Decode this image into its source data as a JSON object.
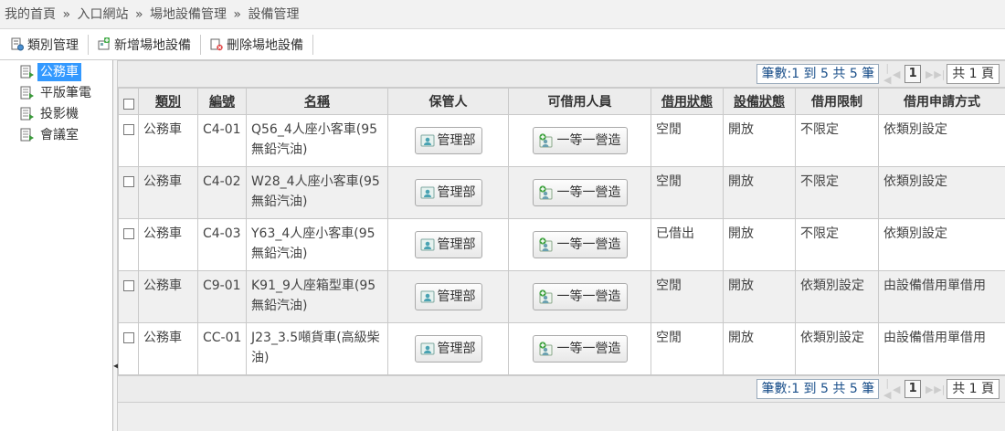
{
  "breadcrumb": {
    "home": "我的首頁",
    "portal": "入口網站",
    "venue": "場地設備管理",
    "current": "設備管理",
    "sep": "»"
  },
  "toolbar": {
    "category_label": "類別管理",
    "add_label": "新增場地設備",
    "delete_label": "刪除場地設備"
  },
  "sidebar": {
    "items": [
      {
        "label": "公務車"
      },
      {
        "label": "平版筆電"
      },
      {
        "label": "投影機"
      },
      {
        "label": "會議室"
      }
    ]
  },
  "pager": {
    "count_text": "筆數:1 到 5 共 5 筆",
    "current_page": "1",
    "total_text": "共 1 頁"
  },
  "table": {
    "headers": {
      "category": "類別",
      "code": "編號",
      "name": "名稱",
      "keeper": "保管人",
      "borrowers": "可借用人員",
      "loan_status": "借用狀態",
      "equip_status": "設備狀態",
      "limit": "借用限制",
      "apply_method": "借用申請方式"
    },
    "rows": [
      {
        "category": "公務車",
        "code": "C4-01",
        "name": "Q56_4人座小客車(95無鉛汽油)",
        "keeper": "管理部",
        "borrowers": "一等一營造",
        "loan_status": "空閒",
        "equip_status": "開放",
        "limit": "不限定",
        "apply_method": "依類別設定"
      },
      {
        "category": "公務車",
        "code": "C4-02",
        "name": "W28_4人座小客車(95無鉛汽油)",
        "keeper": "管理部",
        "borrowers": "一等一營造",
        "loan_status": "空閒",
        "equip_status": "開放",
        "limit": "不限定",
        "apply_method": "依類別設定"
      },
      {
        "category": "公務車",
        "code": "C4-03",
        "name": "Y63_4人座小客車(95無鉛汽油)",
        "keeper": "管理部",
        "borrowers": "一等一營造",
        "loan_status": "已借出",
        "equip_status": "開放",
        "limit": "不限定",
        "apply_method": "依類別設定"
      },
      {
        "category": "公務車",
        "code": "C9-01",
        "name": "K91_9人座箱型車(95無鉛汽油)",
        "keeper": "管理部",
        "borrowers": "一等一營造",
        "loan_status": "空閒",
        "equip_status": "開放",
        "limit": "依類別設定",
        "apply_method": "由設備借用單借用"
      },
      {
        "category": "公務車",
        "code": "CC-01",
        "name": "J23_3.5噸貨車(高級柴油)",
        "keeper": "管理部",
        "borrowers": "一等一營造",
        "loan_status": "空閒",
        "equip_status": "開放",
        "limit": "依類別設定",
        "apply_method": "由設備借用單借用"
      }
    ]
  },
  "colors": {
    "accent": "#3399ff",
    "link": "#1a5fa0"
  },
  "icons": {
    "category": "document-settings-icon",
    "add": "add-venue-icon",
    "delete": "delete-venue-icon",
    "sidebar": "equipment-node-icon",
    "keeper": "user-card-icon",
    "borrowers": "add-user-icon"
  }
}
